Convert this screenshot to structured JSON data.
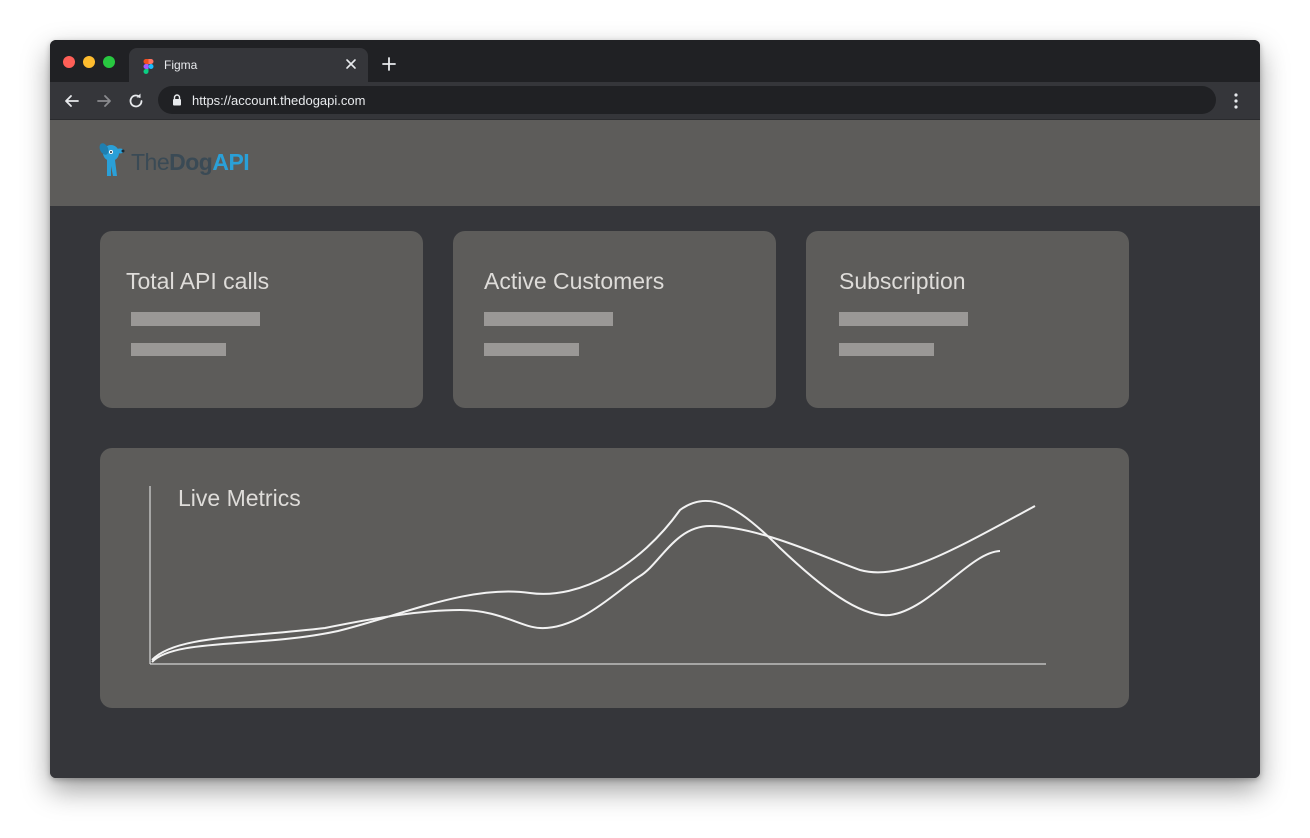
{
  "browser": {
    "tab_title": "Figma",
    "url": "https://account.thedogapi.com"
  },
  "site": {
    "logo": {
      "part1": "The",
      "part2": "Dog",
      "part3": "API"
    }
  },
  "cards": [
    {
      "title": "Total API calls"
    },
    {
      "title": "Active Customers"
    },
    {
      "title": "Subscription"
    }
  ],
  "metrics": {
    "title": "Live Metrics"
  },
  "colors": {
    "logo_accent": "#2aa0d8",
    "logo_text": "#3a4a55",
    "card_bg": "#5d5c5a",
    "page_bg": "#35363a"
  }
}
